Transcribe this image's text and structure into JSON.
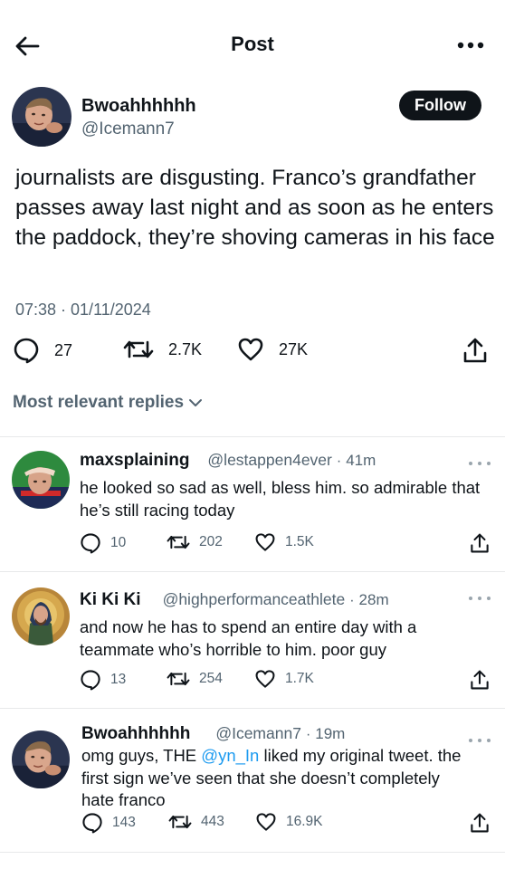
{
  "header": {
    "title": "Post"
  },
  "post": {
    "author_name": "Bwoahhhhhh",
    "author_handle": "@Icemann7",
    "follow_label": "Follow",
    "text": "journalists are disgusting. Franco’s grandfather passes away last night and as soon as he enters the paddock, they’re shoving cameras in his face",
    "timestamp": "07:38 · 01/11/2024",
    "replies": "27",
    "reposts": "2.7K",
    "likes": "27K"
  },
  "replies_header": "Most relevant replies",
  "replies": [
    {
      "name": "maxsplaining",
      "handle": "@lestappen4ever",
      "time": "41m",
      "text": "he looked so sad as well, bless him. so admirable that he’s still racing today",
      "replies": "10",
      "reposts": "202",
      "likes": "1.5K"
    },
    {
      "name": "Ki Ki Ki",
      "handle": "@highperformanceathlete",
      "time": "28m",
      "text": "and now he has to spend an entire day with a teammate who’s horrible to him. poor guy",
      "replies": "13",
      "reposts": "254",
      "likes": "1.7K"
    },
    {
      "name": "Bwoahhhhhh",
      "handle": "@Icemann7",
      "time": "19m",
      "text_before": "omg guys, THE ",
      "mention": "@yn_In",
      "text_after": " liked my original tweet. the first sign we’ve seen that she doesn’t completely hate franco",
      "replies": "143",
      "reposts": "443",
      "likes": "16.9K"
    }
  ],
  "icons": {
    "back": "arrow-left-icon",
    "more": "more-horizontal-icon",
    "reply": "reply-bubble-icon",
    "repost": "repost-icon",
    "like": "heart-icon",
    "share": "share-upload-icon",
    "chevron": "chevron-down-icon"
  },
  "colors": {
    "text": "#0f1419",
    "secondary": "#536471",
    "mention": "#1d9bf0",
    "follow_bg": "#0f1419",
    "divider": "#e7e9ea"
  }
}
